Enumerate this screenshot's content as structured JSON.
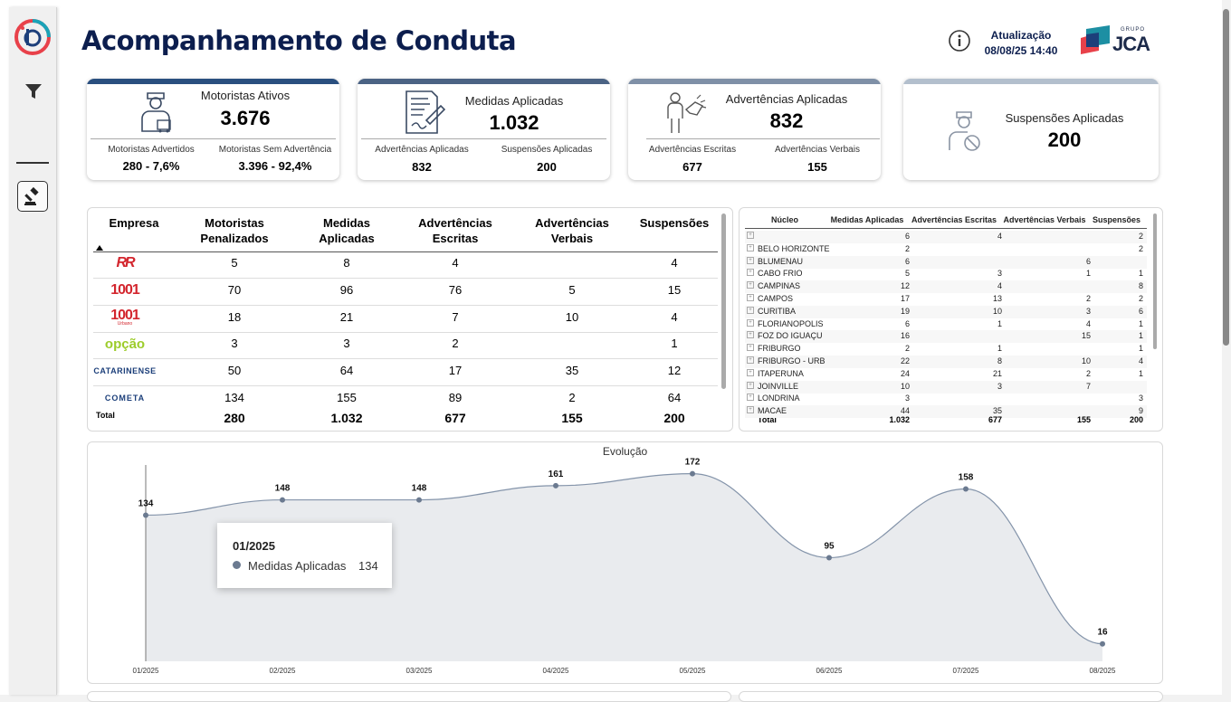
{
  "header": {
    "title": "Acompanhamento de Conduta",
    "update_label": "Atualização",
    "update_value": "08/08/25 14:40",
    "logo_small": "GRUPO",
    "logo_big": "JCA"
  },
  "kpis": {
    "motoristas": {
      "title": "Motoristas Ativos",
      "value": "3.676",
      "sub1_label": "Motoristas Advertidos",
      "sub1_value": "280 - 7,6%",
      "sub2_label": "Motoristas Sem Advertência",
      "sub2_value": "3.396 - 92,4%",
      "color": "#2a4f7f"
    },
    "medidas": {
      "title": "Medidas Aplicadas",
      "value": "1.032",
      "sub1_label": "Advertências Aplicadas",
      "sub1_value": "832",
      "sub2_label": "Suspensões Aplicadas",
      "sub2_value": "200",
      "color": "#4b6384"
    },
    "advertencias": {
      "title": "Advertências Aplicadas",
      "value": "832",
      "sub1_label": "Advertências Escritas",
      "sub1_value": "677",
      "sub2_label": "Advertências Verbais",
      "sub2_value": "155",
      "color": "#7f90a7"
    },
    "suspensoes": {
      "title": "Suspensões Aplicadas",
      "value": "200",
      "color": "#b3bfcd"
    }
  },
  "empresa_table": {
    "headers": [
      "Empresa",
      "Motoristas Penalizados",
      "Medidas Aplicadas",
      "Advertências Escritas",
      "Advertências Verbais",
      "Suspensões"
    ],
    "rows": [
      {
        "logo": "RR",
        "cells": [
          "5",
          "8",
          "4",
          "",
          "4"
        ]
      },
      {
        "logo": "1001",
        "cells": [
          "70",
          "96",
          "76",
          "5",
          "15"
        ]
      },
      {
        "logo": "1001",
        "logo_sub": "Urbano",
        "cells": [
          "18",
          "21",
          "7",
          "10",
          "4"
        ]
      },
      {
        "logo": "opção",
        "cells": [
          "3",
          "3",
          "2",
          "",
          "1"
        ]
      },
      {
        "logo": "CATARINENSE",
        "cells": [
          "50",
          "64",
          "17",
          "35",
          "12"
        ]
      },
      {
        "logo": "COMETA",
        "cells": [
          "134",
          "155",
          "89",
          "2",
          "64"
        ]
      }
    ],
    "total_label": "Total",
    "total": [
      "280",
      "1.032",
      "677",
      "155",
      "200"
    ]
  },
  "nucleo_table": {
    "headers": [
      "Núcleo",
      "Medidas Aplicadas",
      "Advertências Escritas",
      "Advertências Verbais",
      "Suspensões"
    ],
    "rows": [
      [
        "",
        "6",
        "4",
        "",
        "2"
      ],
      [
        "BELO HORIZONTE",
        "2",
        "",
        "",
        "2"
      ],
      [
        "BLUMENAU",
        "6",
        "",
        "6",
        ""
      ],
      [
        "CABO FRIO",
        "5",
        "3",
        "1",
        "1"
      ],
      [
        "CAMPINAS",
        "12",
        "4",
        "",
        "8"
      ],
      [
        "CAMPOS",
        "17",
        "13",
        "2",
        "2"
      ],
      [
        "CURITIBA",
        "19",
        "10",
        "3",
        "6"
      ],
      [
        "FLORIANOPOLIS",
        "6",
        "1",
        "4",
        "1"
      ],
      [
        "FOZ DO IGUAÇU",
        "16",
        "",
        "15",
        "1"
      ],
      [
        "FRIBURGO",
        "2",
        "1",
        "",
        "1"
      ],
      [
        "FRIBURGO - URB",
        "22",
        "8",
        "10",
        "4"
      ],
      [
        "ITAPERUNA",
        "24",
        "21",
        "2",
        "1"
      ],
      [
        "JOINVILLE",
        "10",
        "3",
        "7",
        ""
      ],
      [
        "LONDRINA",
        "3",
        "",
        "",
        "3"
      ],
      [
        "MACAE",
        "44",
        "35",
        "",
        "9"
      ]
    ],
    "total_label": "Total",
    "total": [
      "1.032",
      "677",
      "155",
      "200"
    ]
  },
  "chart_data": {
    "type": "area",
    "title": "Evolução",
    "categories": [
      "01/2025",
      "02/2025",
      "03/2025",
      "04/2025",
      "05/2025",
      "06/2025",
      "07/2025",
      "08/2025"
    ],
    "series": [
      {
        "name": "Medidas Aplicadas",
        "values": [
          134,
          148,
          148,
          161,
          172,
          95,
          158,
          16
        ]
      }
    ],
    "color": "#8494aa",
    "fill": "#e9ebee"
  },
  "tooltip": {
    "title": "01/2025",
    "label": "Medidas Aplicadas",
    "value": "134"
  }
}
